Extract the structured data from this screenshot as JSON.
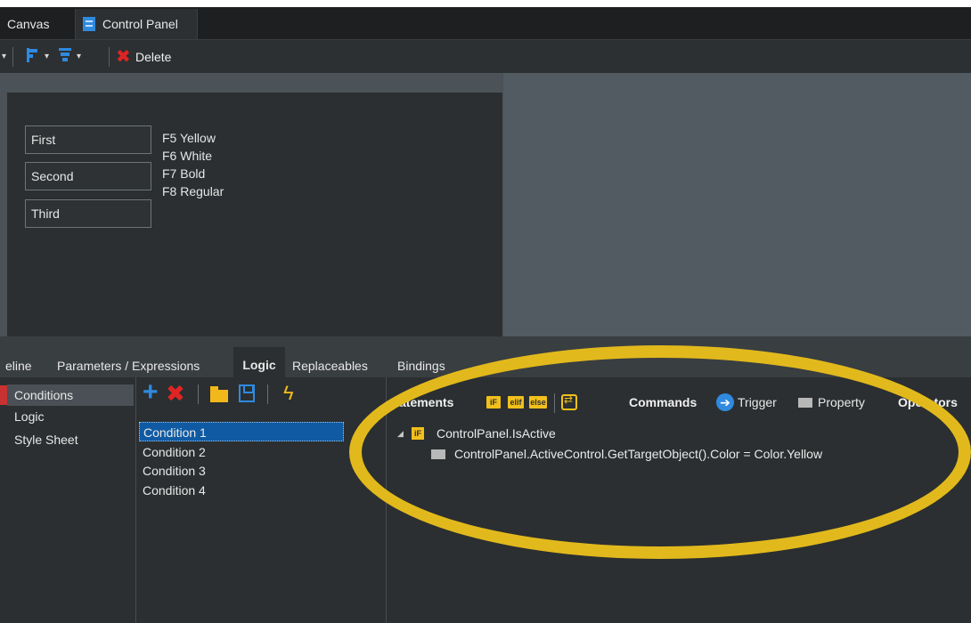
{
  "tabs": [
    {
      "label": "Canvas"
    },
    {
      "label": "Control Panel"
    }
  ],
  "toolbar": {
    "delete_label": "Delete"
  },
  "canvas": {
    "fields": [
      {
        "value": "First"
      },
      {
        "value": "Second"
      },
      {
        "value": "Third"
      }
    ],
    "shortcuts": [
      "F5 Yellow",
      "F6 White",
      "F7 Bold",
      "F8 Regular"
    ]
  },
  "bottom_tabs": [
    {
      "label": "eline"
    },
    {
      "label": "Parameters / Expressions"
    },
    {
      "label": "Logic"
    },
    {
      "label": "Replaceables"
    },
    {
      "label": "Bindings"
    }
  ],
  "nav": {
    "items": [
      {
        "label": "Conditions"
      },
      {
        "label": "Logic"
      },
      {
        "label": "Style Sheet"
      }
    ]
  },
  "conditions": {
    "items": [
      {
        "label": "Condition 1"
      },
      {
        "label": "Condition 2"
      },
      {
        "label": "Condition 3"
      },
      {
        "label": "Condition 4"
      }
    ]
  },
  "statements_header": {
    "statements_label": "Statements",
    "kw_if": "iF",
    "kw_elif": "elif",
    "kw_else": "else",
    "commands_label": "Commands",
    "trigger_label": "Trigger",
    "property_label": "Property",
    "operators_label": "Operators"
  },
  "tree": {
    "condition": "ControlPanel.IsActive",
    "command": "ControlPanel.ActiveControl.GetTargetObject().Color = Color.Yellow"
  },
  "colors": {
    "accent_blue": "#2f8ae0",
    "keyword_yellow": "#f2c01b",
    "annotation_yellow": "#e2b91c",
    "delete_red": "#e02424"
  }
}
